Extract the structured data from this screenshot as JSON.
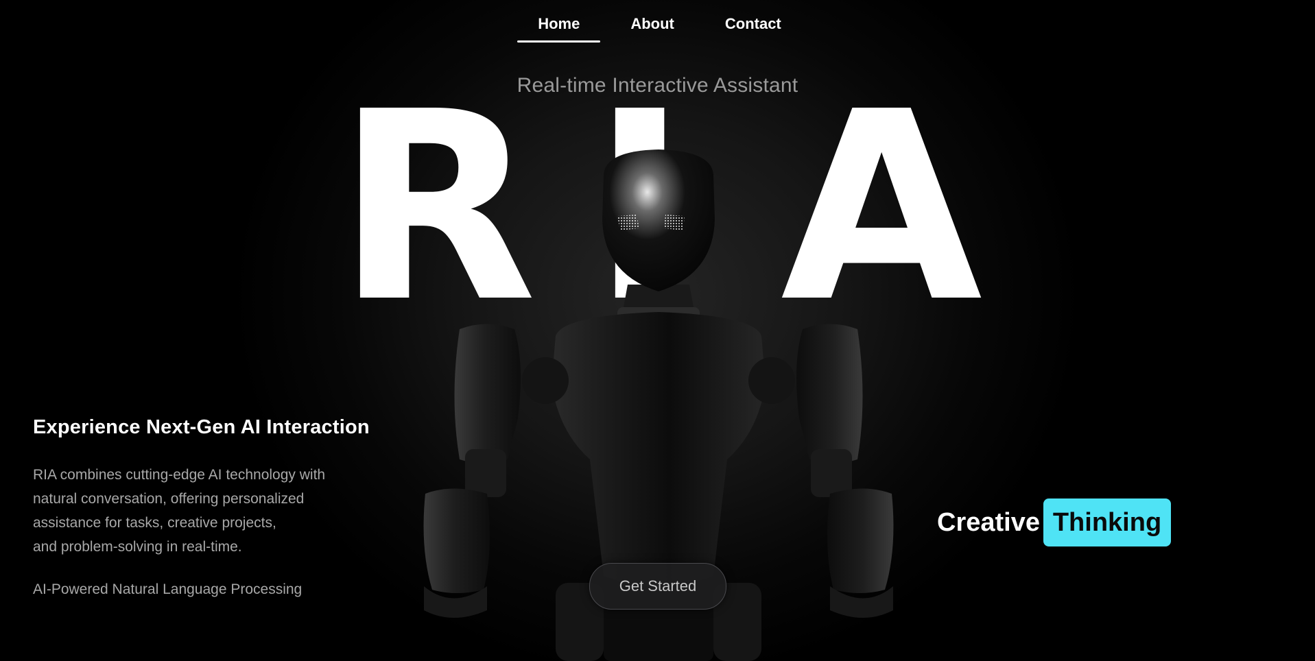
{
  "nav": {
    "items": [
      {
        "label": "Home",
        "active": true
      },
      {
        "label": "About",
        "active": false
      },
      {
        "label": "Contact",
        "active": false
      }
    ]
  },
  "hero": {
    "subtitle": "Real-time Interactive Assistant",
    "letters": [
      "R",
      "I",
      "A"
    ]
  },
  "intro": {
    "headline": "Experience Next-Gen AI Interaction",
    "description_lines": [
      "RIA combines cutting-edge AI technology with",
      "natural conversation, offering personalized",
      "assistance for tasks, creative projects,",
      "and problem-solving in real-time."
    ],
    "feature": "AI-Powered Natural Language Processing"
  },
  "cta": {
    "label": "Get Started"
  },
  "tagline": {
    "word1": "Creative",
    "word2": "Thinking",
    "highlight_color": "#4fe3f5"
  },
  "colors": {
    "background": "#000000",
    "text_primary": "#ffffff",
    "text_muted": "#a8a8a8"
  },
  "icons": {
    "robot": "robot-figure"
  }
}
